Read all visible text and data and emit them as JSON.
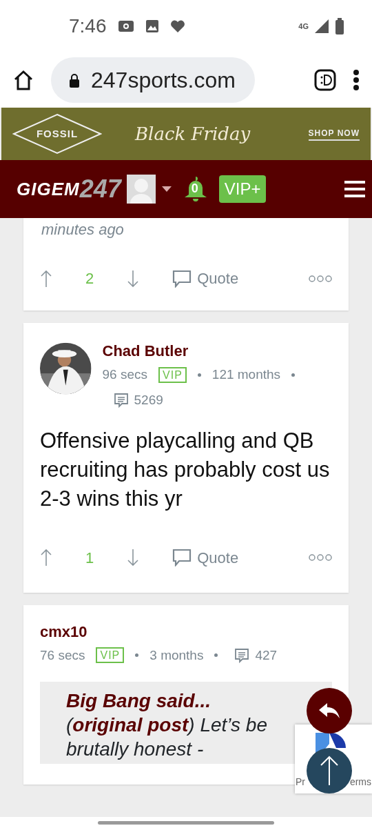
{
  "status_bar": {
    "time": "7:46",
    "network": "4G"
  },
  "browser": {
    "url": "247sports.com"
  },
  "ad": {
    "brand": "FOSSIL",
    "headline": "Black Friday",
    "cta": "SHOP NOW"
  },
  "header": {
    "logo_main": "GIGEM",
    "logo_num": "247",
    "notifications": "0",
    "vip": "VIP+"
  },
  "posts": [
    {
      "kind": "tail",
      "meta": "minutes ago",
      "votes": "2",
      "quote_label": "Quote"
    },
    {
      "kind": "full",
      "author": "Chad Butler",
      "time": "96 secs",
      "badge": "VIP",
      "tenure": "121 months",
      "post_count": "5269",
      "body": "Offensive playcalling and QB recruiting has probably cost us 2-3 wins this yr",
      "votes": "1",
      "quote_label": "Quote"
    },
    {
      "kind": "quoting",
      "author": "cmx10",
      "time": "76 secs",
      "badge": "VIP",
      "tenure": "3 months",
      "post_count": "427",
      "quoted_author": "Big Bang said...",
      "quoted_text": "(**original post**) Let’s be brutally honest -"
    }
  ],
  "recaptcha": {
    "left": "Pr",
    "right": "erms"
  }
}
